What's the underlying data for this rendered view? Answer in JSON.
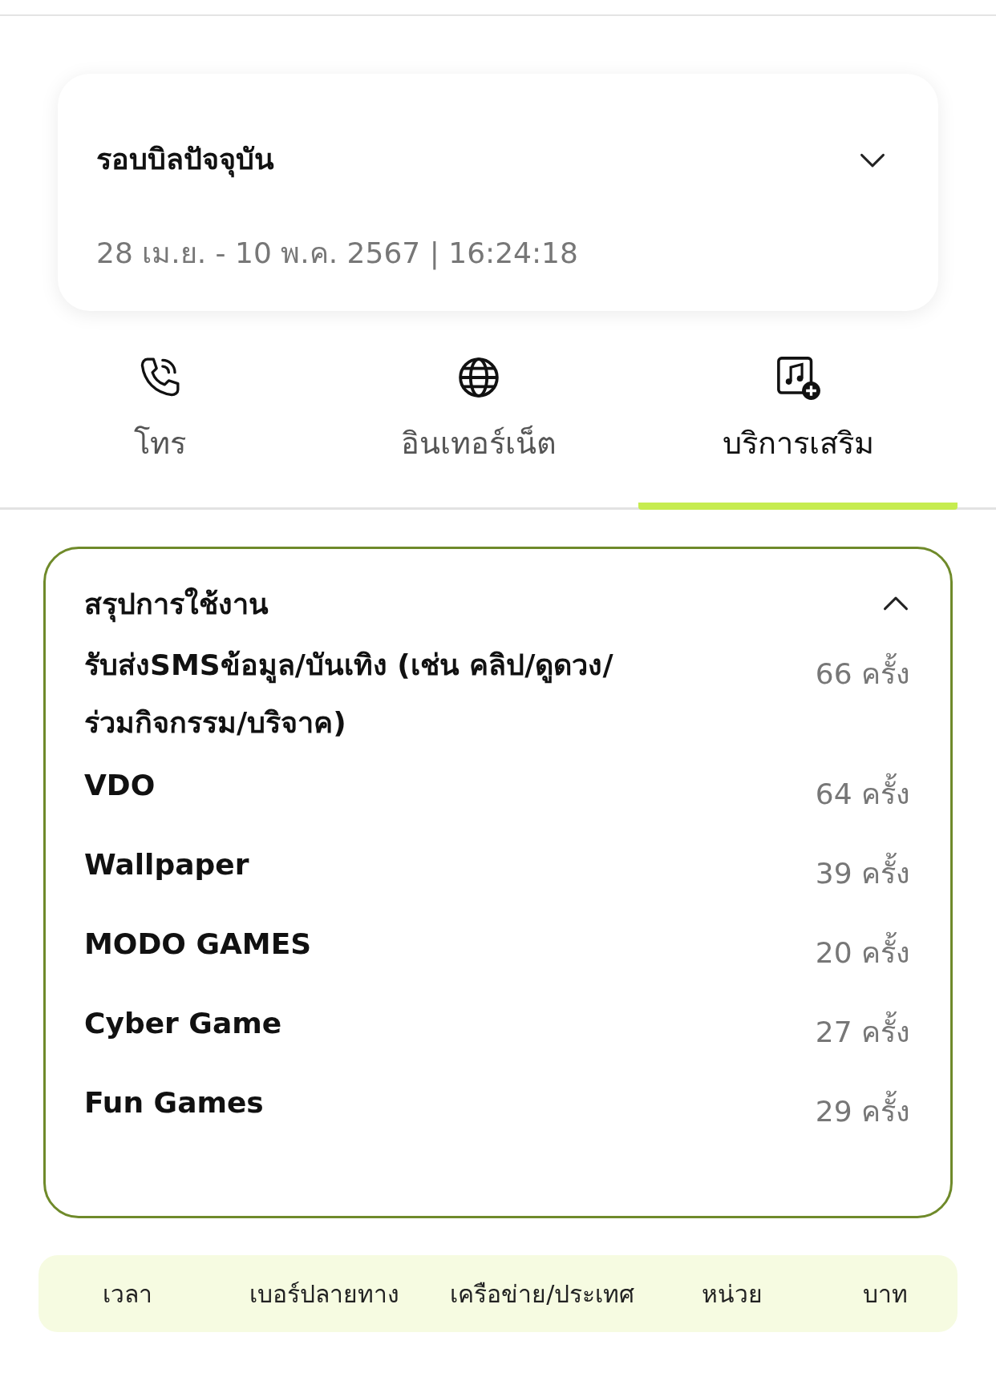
{
  "bill_cycle": {
    "title": "รอบบิลปัจจุบัน",
    "period": "28 เม.ย. - 10 พ.ค. 2567 | 16:24:18",
    "expanded": false
  },
  "tabs": [
    {
      "label": "โทร",
      "kind": "phone",
      "selected": false
    },
    {
      "label": "อินเทอร์เน็ต",
      "kind": "globe",
      "selected": false
    },
    {
      "label": "บริการเสริม",
      "kind": "media",
      "selected": true
    }
  ],
  "summary": {
    "title": "สรุปการใช้งาน",
    "expanded": true,
    "rows": [
      {
        "name": "รับส่งSMSข้อมูล/บันเทิง (เช่น คลิป/ดูดวง/ร่วมกิจกรรม/บริจาค)",
        "count": "66 ครั้ง"
      },
      {
        "name": "VDO",
        "count": "64 ครั้ง"
      },
      {
        "name": "Wallpaper",
        "count": "39 ครั้ง"
      },
      {
        "name": "MODO GAMES",
        "count": "20 ครั้ง"
      },
      {
        "name": "Cyber Game",
        "count": "27 ครั้ง"
      },
      {
        "name": "Fun Games",
        "count": "29 ครั้ง"
      }
    ]
  },
  "table": {
    "columns": [
      "เวลา",
      "เบอร์ปลายทาง",
      "เครือข่าย/ประเทศ",
      "หน่วย",
      "บาท"
    ]
  }
}
